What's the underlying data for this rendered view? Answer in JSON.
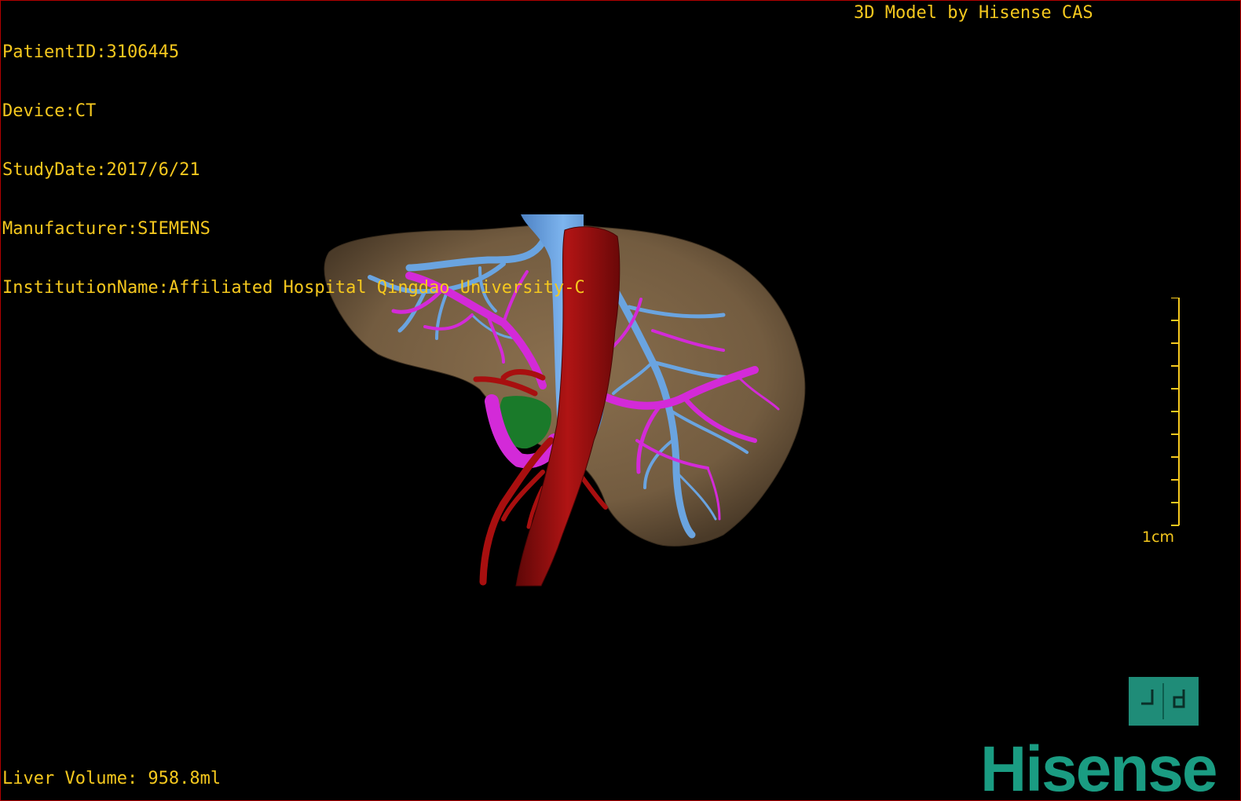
{
  "study_info": {
    "patient_id": "PatientID:3106445",
    "device": "Device:CT",
    "study_date": "StudyDate:2017/6/21",
    "manufacturer": "Manufacturer:SIEMENS",
    "institution": "InstitutionName:Affiliated Hospital Qingdao University-C"
  },
  "model_credit": "3D Model by Hisense CAS",
  "liver_volume": "Liver Volume: 958.8ml",
  "scale": {
    "label": "1cm",
    "tick_count": 10
  },
  "brand": {
    "logo_text": "Hisense",
    "logo_color": "#1a9c82"
  },
  "model": {
    "structures": [
      "liver",
      "hepatic-veins",
      "portal-veins",
      "inferior-vena-cava",
      "aorta",
      "gallbladder"
    ],
    "colors": {
      "liver": "#7d6446",
      "hepatic_veins": "#6aa4e0",
      "portal_veins": "#d32ad8",
      "arteries": "#a80f0f",
      "gallbladder": "#1a7a2a",
      "text": "#f5c81e"
    }
  },
  "orientation_cube": {
    "icon": "orientation-cube-icon",
    "color": "#1f8c78"
  }
}
